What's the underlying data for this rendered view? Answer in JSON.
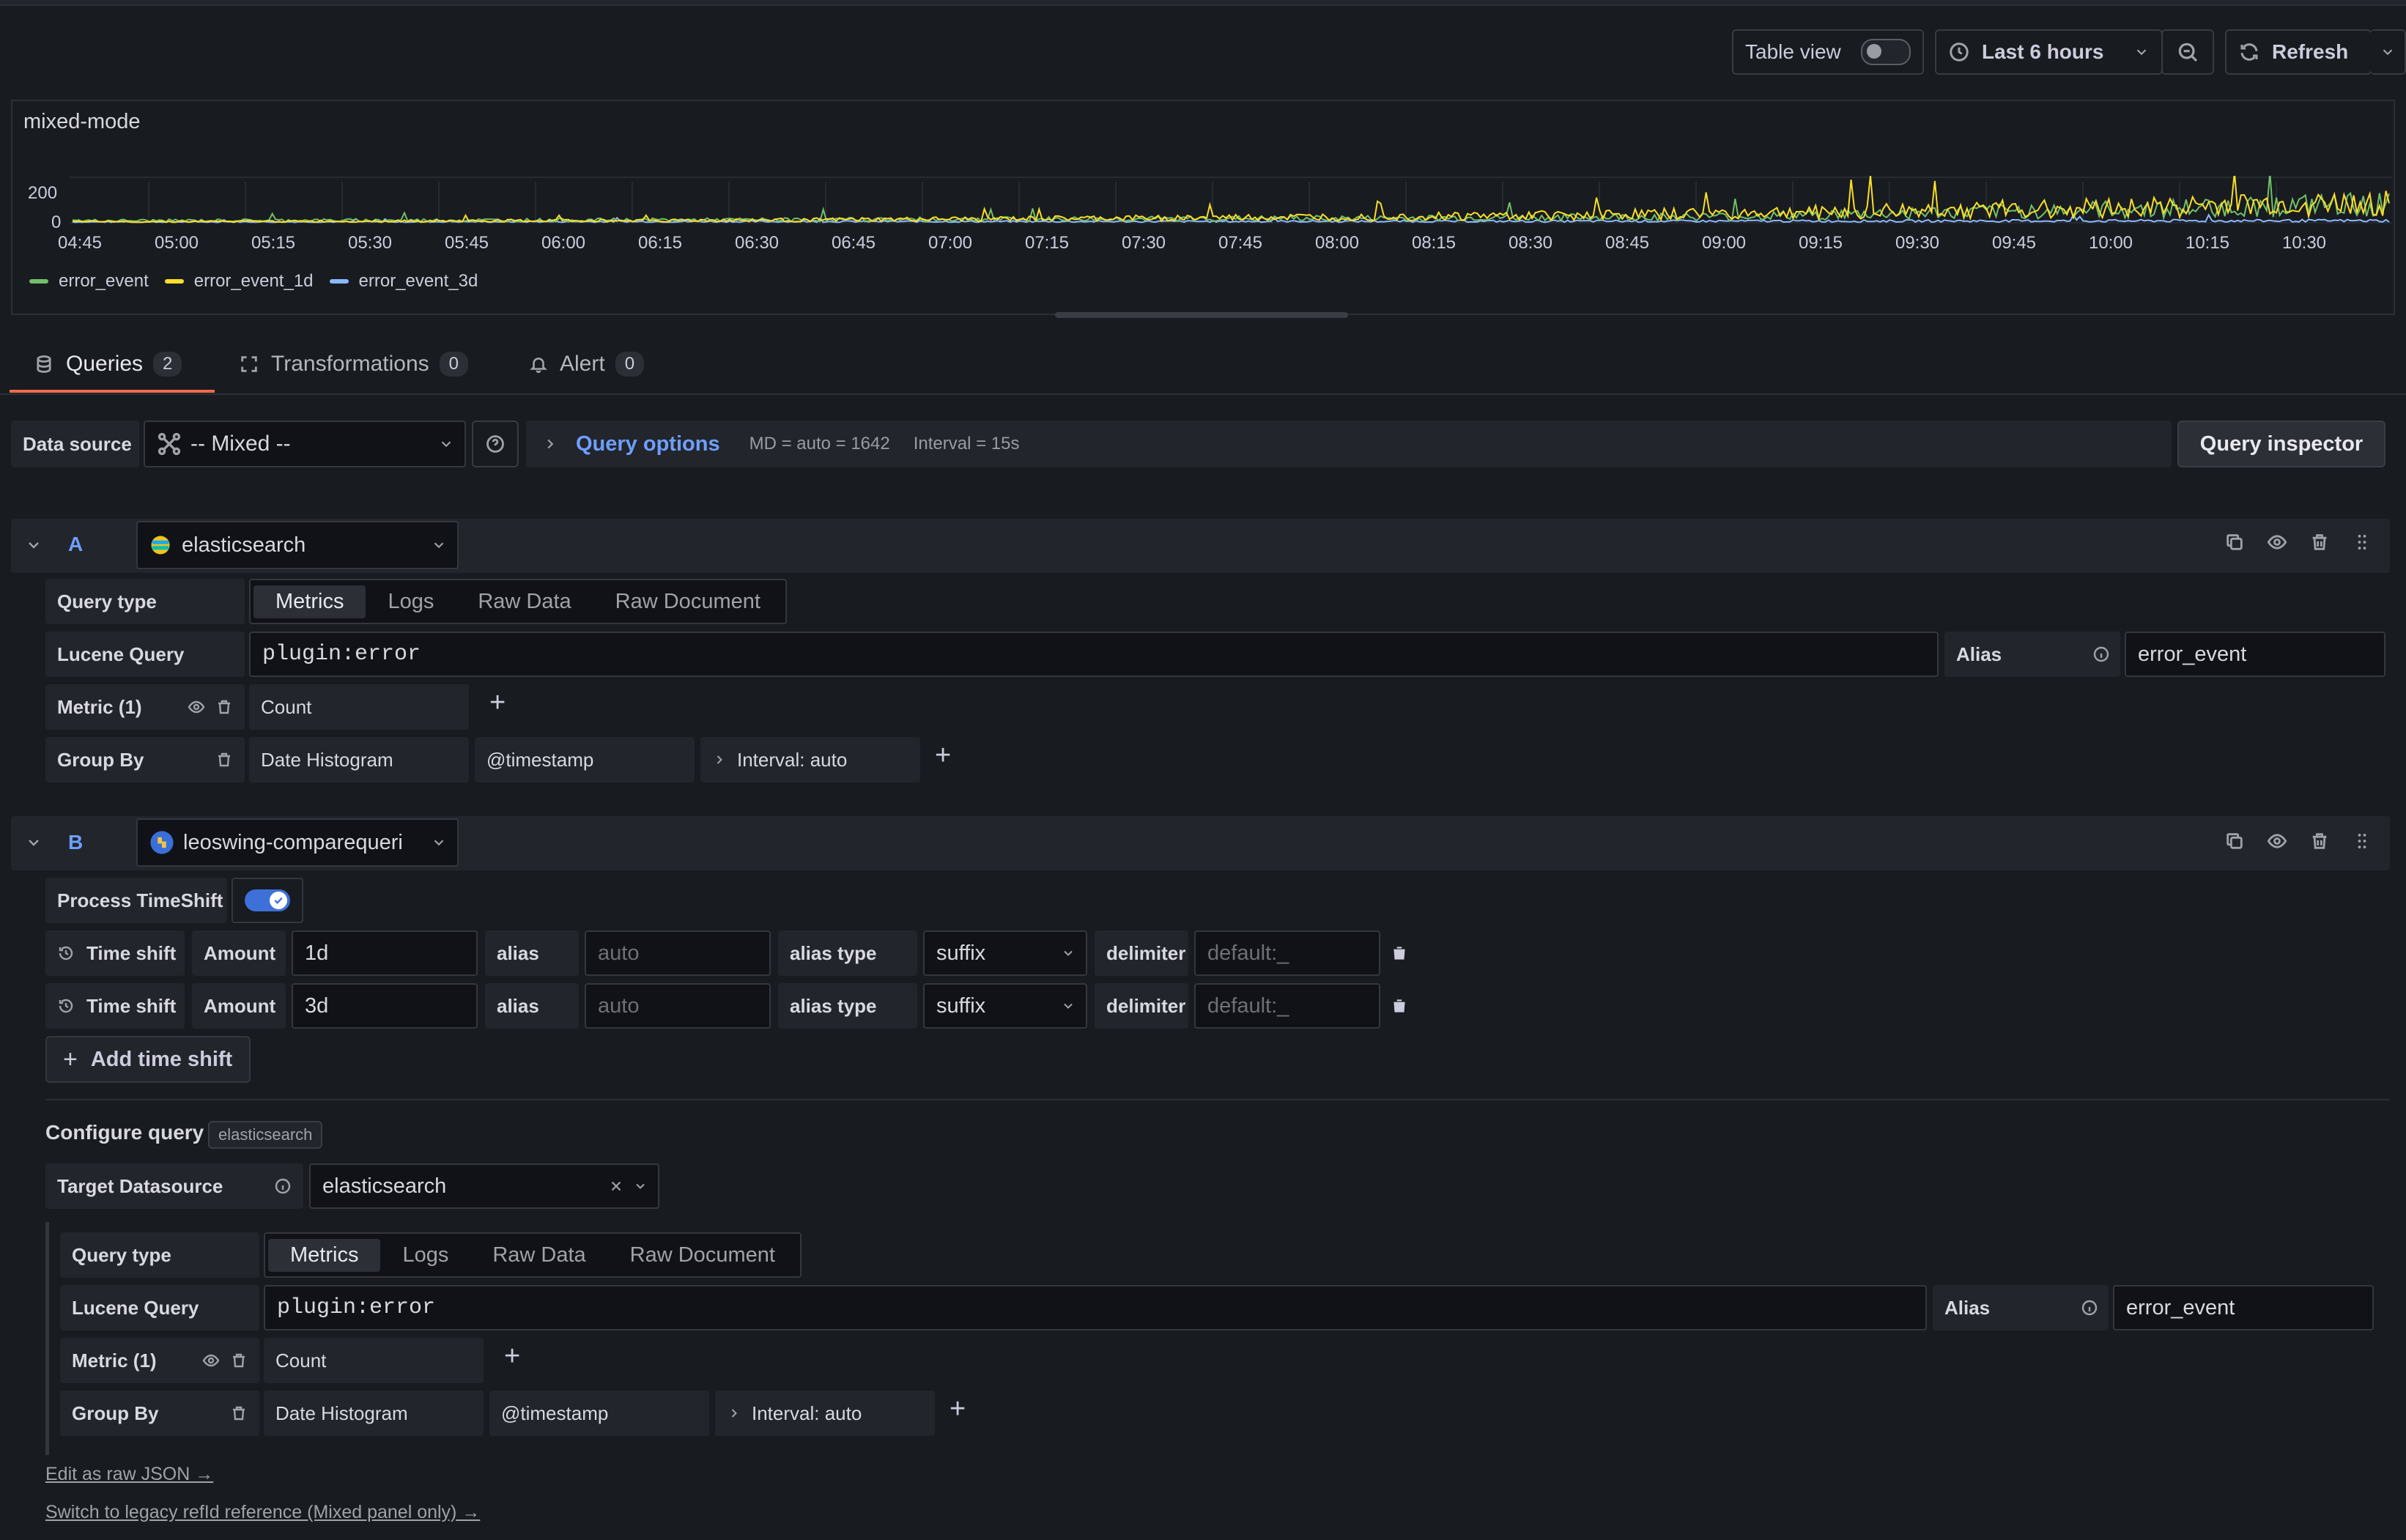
{
  "toolbar": {
    "table_view_label": "Table view",
    "time_range_label": "Last 6 hours",
    "refresh_label": "Refresh"
  },
  "panel": {
    "title": "mixed-mode",
    "legend": [
      {
        "name": "error_event",
        "color": "#73bf69"
      },
      {
        "name": "error_event_1d",
        "color": "#fade2a"
      },
      {
        "name": "error_event_3d",
        "color": "#8ab8ff"
      }
    ]
  },
  "chart_data": {
    "type": "line",
    "x_ticks": [
      "04:45",
      "05:00",
      "05:15",
      "05:30",
      "05:45",
      "06:00",
      "06:15",
      "06:30",
      "06:45",
      "07:00",
      "07:15",
      "07:30",
      "07:45",
      "08:00",
      "08:15",
      "08:30",
      "08:45",
      "09:00",
      "09:15",
      "09:30",
      "09:45",
      "10:00",
      "10:15",
      "10:30"
    ],
    "y_ticks": [
      0,
      200
    ],
    "ylim": [
      0,
      200
    ],
    "grid": true,
    "legend_position": "bottom-left",
    "series": [
      {
        "name": "error_event",
        "color": "#73bf69",
        "approx_levels": [
          10,
          12,
          14,
          18,
          22,
          30,
          60,
          90
        ]
      },
      {
        "name": "error_event_1d",
        "color": "#fade2a",
        "approx_levels": [
          5,
          8,
          12,
          20,
          30,
          45,
          70,
          95
        ]
      },
      {
        "name": "error_event_3d",
        "color": "#8ab8ff",
        "approx_levels": [
          4,
          5,
          6,
          6,
          7,
          8,
          9,
          10
        ]
      }
    ]
  },
  "tabs": [
    {
      "label": "Queries",
      "count": "2"
    },
    {
      "label": "Transformations",
      "count": "0"
    },
    {
      "label": "Alert",
      "count": "0"
    }
  ],
  "datasource_row": {
    "label": "Data source",
    "value": "-- Mixed --",
    "query_options_label": "Query options",
    "md": "MD = auto = 1642",
    "interval": "Interval = 15s",
    "inspector_label": "Query inspector"
  },
  "query_a": {
    "letter": "A",
    "datasource": "elasticsearch",
    "query_type_label": "Query type",
    "query_types": [
      "Metrics",
      "Logs",
      "Raw Data",
      "Raw Document"
    ],
    "lucene_label": "Lucene Query",
    "lucene_value": "plugin:error",
    "alias_label": "Alias",
    "alias_value": "error_event",
    "metric_label": "Metric (1)",
    "metric_value": "Count",
    "groupby_label": "Group By",
    "groupby_type": "Date Histogram",
    "groupby_field": "@timestamp",
    "groupby_interval": "Interval: auto"
  },
  "query_b": {
    "letter": "B",
    "datasource": "leoswing-comparequeri",
    "process_timeshift_label": "Process TimeShift",
    "timeshifts": [
      {
        "label": "Time shift",
        "amount_label": "Amount",
        "amount": "1d",
        "alias_label": "alias",
        "alias_placeholder": "auto",
        "alias_type_label": "alias type",
        "alias_type": "suffix",
        "delimiter_label": "delimiter",
        "delimiter_placeholder": "default:_"
      },
      {
        "label": "Time shift",
        "amount_label": "Amount",
        "amount": "3d",
        "alias_label": "alias",
        "alias_placeholder": "auto",
        "alias_type_label": "alias type",
        "alias_type": "suffix",
        "delimiter_label": "delimiter",
        "delimiter_placeholder": "default:_"
      }
    ],
    "add_timeshift_label": "Add time shift",
    "configure_label": "Configure query",
    "configure_badge": "elasticsearch",
    "target_ds_label": "Target Datasource",
    "target_ds_value": "elasticsearch",
    "query_type_label": "Query type",
    "query_types": [
      "Metrics",
      "Logs",
      "Raw Data",
      "Raw Document"
    ],
    "lucene_label": "Lucene Query",
    "lucene_value": "plugin:error",
    "alias_label": "Alias",
    "alias_value": "error_event",
    "metric_label": "Metric (1)",
    "metric_value": "Count",
    "groupby_label": "Group By",
    "groupby_type": "Date Histogram",
    "groupby_field": "@timestamp",
    "groupby_interval": "Interval: auto"
  },
  "links": {
    "raw_json": "Edit as raw JSON →",
    "legacy": "Switch to legacy refId reference (Mixed panel only) →"
  }
}
